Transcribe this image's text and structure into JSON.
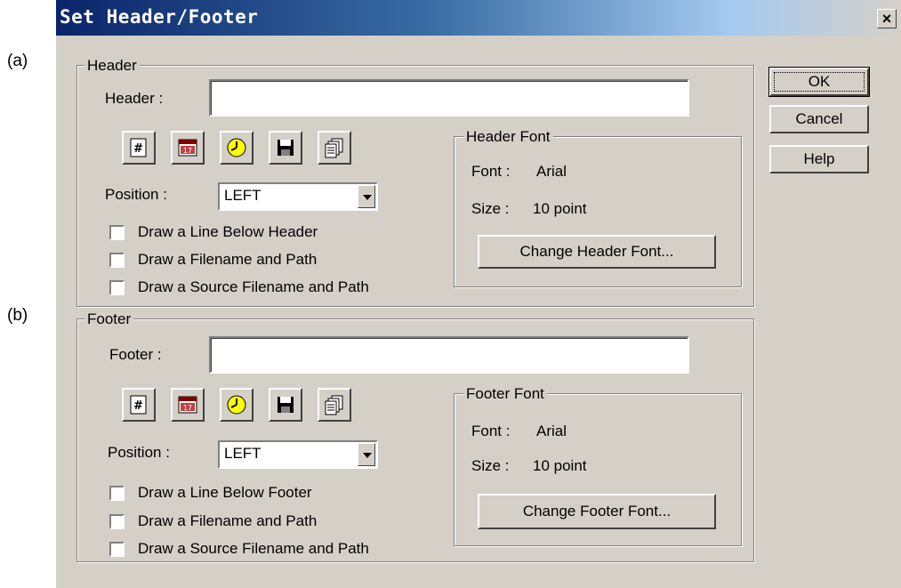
{
  "annotations": {
    "a": "(a)",
    "b": "(b)"
  },
  "window": {
    "title": "Set Header/Footer",
    "close": "×"
  },
  "header": {
    "group_label": "Header",
    "field_label": "Header :",
    "field_value": "",
    "position_label": "Position :",
    "position_value": "LEFT",
    "checkboxes": [
      "Draw a Line Below Header",
      "Draw a Filename and Path",
      "Draw a Source Filename and Path"
    ],
    "font_group_label": "Header Font",
    "font_label": "Font :",
    "font_value": "Arial",
    "size_label": "Size :",
    "size_value": "10 point",
    "change_font_button": "Change Header Font..."
  },
  "footer": {
    "group_label": "Footer",
    "field_label": "Footer :",
    "field_value": "",
    "position_label": "Position :",
    "position_value": "LEFT",
    "checkboxes": [
      "Draw a Line Below Footer",
      "Draw a Filename and Path",
      "Draw a Source Filename and Path"
    ],
    "font_group_label": "Footer Font",
    "font_label": "Font :",
    "font_value": "Arial",
    "size_label": "Size :",
    "size_value": "10 point",
    "change_font_button": "Change Footer Font..."
  },
  "buttons": {
    "ok": "OK",
    "cancel": "Cancel",
    "help": "Help"
  },
  "icons": [
    "page-number-icon",
    "date-icon",
    "time-icon",
    "save-icon",
    "copy-icon"
  ]
}
